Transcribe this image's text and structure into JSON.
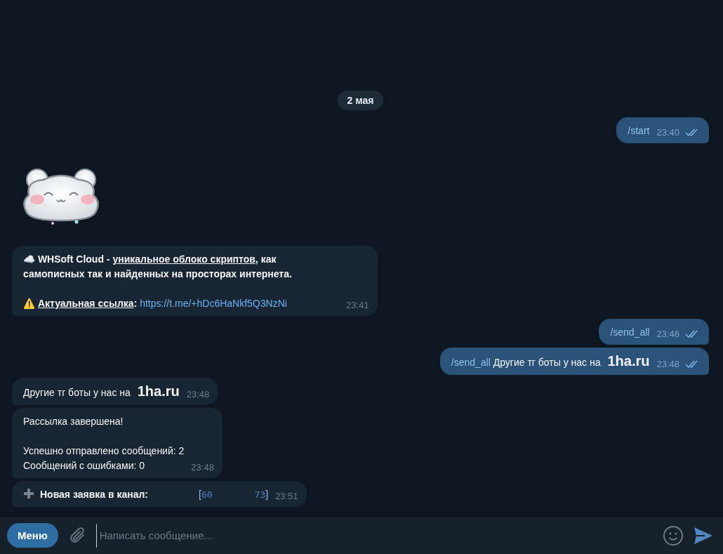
{
  "date_separator": "2 мая",
  "messages": [
    {
      "kind": "outgoing",
      "read": true,
      "time": "23:40",
      "segments": [
        {
          "kind": "command",
          "text": "/start"
        }
      ]
    },
    {
      "kind": "sticker"
    },
    {
      "kind": "incoming",
      "time": "23:41",
      "segments": [
        {
          "kind": "strong",
          "text": "☁️ WHSoft Cloud - "
        },
        {
          "kind": "underline",
          "text": "уникальное облоко скриптов"
        },
        {
          "kind": "strong",
          "text": ", как самописных так и найденных на просторах интернета.\n\n⚠️ "
        },
        {
          "kind": "underline",
          "text": "Актуальная ссылка"
        },
        {
          "kind": "strong",
          "text": ": "
        },
        {
          "kind": "link",
          "text": "https://t.me/+hDc6HaNkf5Q3NzNi"
        }
      ]
    },
    {
      "kind": "outgoing",
      "read": true,
      "time": "23:46",
      "segments": [
        {
          "kind": "command",
          "text": "/send_all"
        }
      ]
    },
    {
      "kind": "outgoing",
      "read": true,
      "time": "23:48",
      "segments": [
        {
          "kind": "command",
          "text": "/send_all"
        },
        {
          "kind": "text",
          "text": " Другие тг боты у нас на "
        },
        {
          "kind": "big",
          "text": "1ha.ru"
        }
      ]
    },
    {
      "kind": "incoming",
      "time": "23:48",
      "segments": [
        {
          "kind": "text",
          "text": "Другие тг боты у нас на "
        },
        {
          "kind": "big",
          "text": "1ha.ru"
        }
      ]
    },
    {
      "kind": "incoming",
      "time": "23:48",
      "segments": [
        {
          "kind": "text",
          "text": "Рассылка завершена!\n\nУспешно отправлено сообщений: 2\nСообщений с ошибками: 0"
        }
      ]
    },
    {
      "kind": "incoming",
      "time": "23:51",
      "segments": [
        {
          "kind": "plus-icon"
        },
        {
          "kind": "strong",
          "text": "Новая заявка в канал:"
        },
        {
          "kind": "bracket",
          "text": "["
        },
        {
          "kind": "mono",
          "text": "60"
        },
        {
          "kind": "mono",
          "text": "73"
        },
        {
          "kind": "bracket",
          "text": "]"
        }
      ]
    }
  ],
  "composer": {
    "menu_button": "Меню",
    "placeholder": "Написать сообщение..."
  }
}
